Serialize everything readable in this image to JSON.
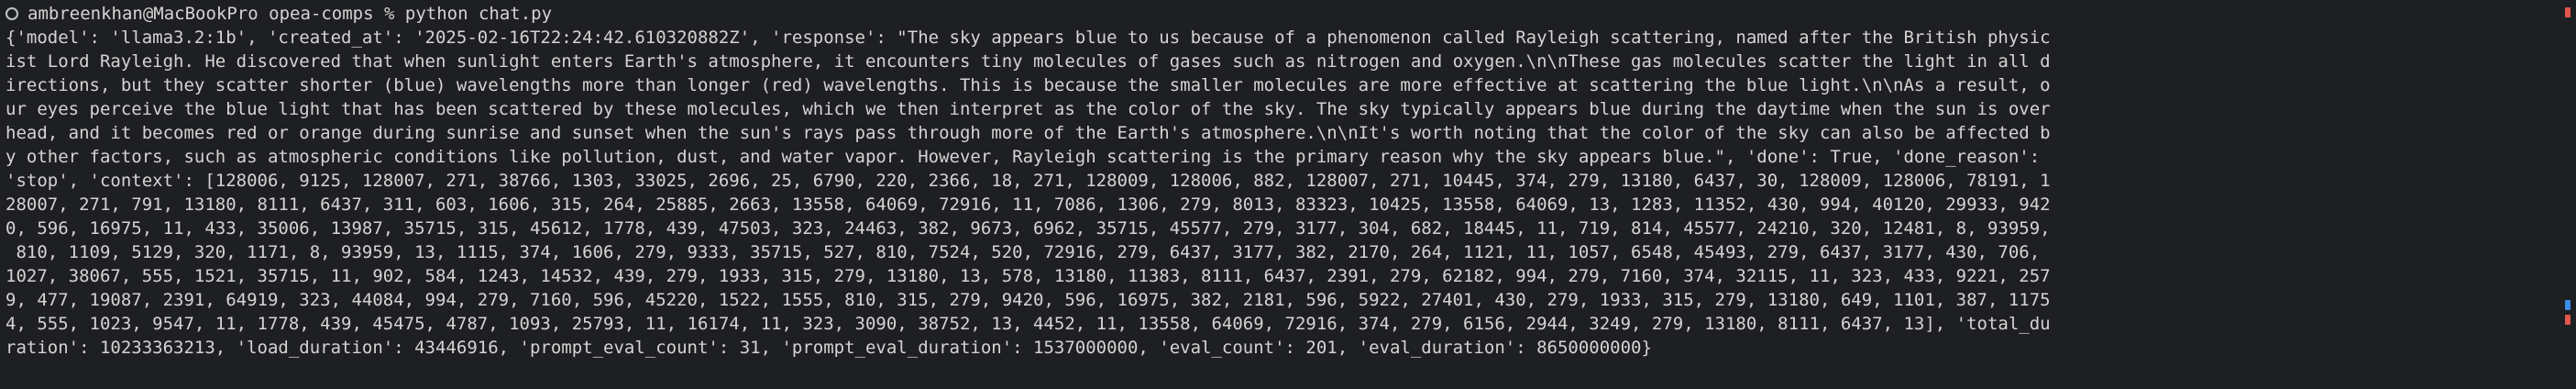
{
  "terminal": {
    "prompt_user_host": "ambreenkhan@MacBookPro",
    "prompt_dir": "opea-comps",
    "prompt_symbol": "%",
    "command": "python chat.py",
    "output_lines": [
      "{'model': 'llama3.2:1b', 'created_at': '2025-02-16T22:24:42.610320882Z', 'response': \"The sky appears blue to us because of a phenomenon called Rayleigh scattering, named after the British physic",
      "ist Lord Rayleigh. He discovered that when sunlight enters Earth's atmosphere, it encounters tiny molecules of gases such as nitrogen and oxygen.\\n\\nThese gas molecules scatter the light in all d",
      "irections, but they scatter shorter (blue) wavelengths more than longer (red) wavelengths. This is because the smaller molecules are more effective at scattering the blue light.\\n\\nAs a result, o",
      "ur eyes perceive the blue light that has been scattered by these molecules, which we then interpret as the color of the sky. The sky typically appears blue during the daytime when the sun is over",
      "head, and it becomes red or orange during sunrise and sunset when the sun's rays pass through more of the Earth's atmosphere.\\n\\nIt's worth noting that the color of the sky can also be affected b",
      "y other factors, such as atmospheric conditions like pollution, dust, and water vapor. However, Rayleigh scattering is the primary reason why the sky appears blue.\", 'done': True, 'done_reason':",
      "'stop', 'context': [128006, 9125, 128007, 271, 38766, 1303, 33025, 2696, 25, 6790, 220, 2366, 18, 271, 128009, 128006, 882, 128007, 271, 10445, 374, 279, 13180, 6437, 30, 128009, 128006, 78191, 1",
      "28007, 271, 791, 13180, 8111, 6437, 311, 603, 1606, 315, 264, 25885, 2663, 13558, 64069, 72916, 11, 7086, 1306, 279, 8013, 83323, 10425, 13558, 64069, 13, 1283, 11352, 430, 994, 40120, 29933, 942",
      "0, 596, 16975, 11, 433, 35006, 13987, 35715, 315, 45612, 1778, 439, 47503, 323, 24463, 382, 9673, 6962, 35715, 45577, 279, 3177, 304, 682, 18445, 11, 719, 814, 45577, 24210, 320, 12481, 8, 93959,",
      " 810, 1109, 5129, 320, 1171, 8, 93959, 13, 1115, 374, 1606, 279, 9333, 35715, 527, 810, 7524, 520, 72916, 279, 6437, 3177, 382, 2170, 264, 1121, 11, 1057, 6548, 45493, 279, 6437, 3177, 430, 706,",
      "1027, 38067, 555, 1521, 35715, 11, 902, 584, 1243, 14532, 439, 279, 1933, 315, 279, 13180, 13, 578, 13180, 11383, 8111, 6437, 2391, 279, 62182, 994, 279, 7160, 374, 32115, 11, 323, 433, 9221, 257",
      "9, 477, 19087, 2391, 64919, 323, 44084, 994, 279, 7160, 596, 45220, 1522, 1555, 810, 315, 279, 9420, 596, 16975, 382, 2181, 596, 5922, 27401, 430, 279, 1933, 315, 279, 13180, 649, 1101, 387, 1175",
      "4, 555, 1023, 9547, 11, 1778, 439, 45475, 4787, 1093, 25793, 11, 16174, 11, 323, 3090, 38752, 13, 4452, 11, 13558, 64069, 72916, 374, 279, 6156, 2944, 3249, 279, 13180, 8111, 6437, 13], 'total_du",
      "ration': 10233363213, 'load_duration': 43446916, 'prompt_eval_count': 31, 'prompt_eval_duration': 1537000000, 'eval_count': 201, 'eval_duration': 8650000000}"
    ]
  },
  "colors": {
    "background": "#1e1f22",
    "text": "#d4d4d4",
    "marker_red": "#e2564d",
    "marker_blue": "#3b8ee8"
  }
}
